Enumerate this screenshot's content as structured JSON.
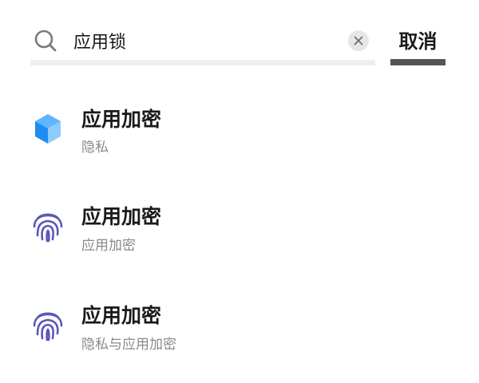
{
  "search": {
    "query": "应用锁",
    "cancel_label": "取消"
  },
  "results": [
    {
      "icon": "privacy-cube-icon",
      "title": "应用加密",
      "subtitle": "隐私"
    },
    {
      "icon": "fingerprint-icon",
      "title": "应用加密",
      "subtitle": "应用加密"
    },
    {
      "icon": "fingerprint-icon",
      "title": "应用加密",
      "subtitle": "隐私与应用加密"
    }
  ],
  "colors": {
    "cube_light": "#5fb6ff",
    "cube_dark": "#1e8cf0",
    "fingerprint": "#5b57b8",
    "underline_active": "#555555",
    "underline_inactive": "#efefef"
  }
}
